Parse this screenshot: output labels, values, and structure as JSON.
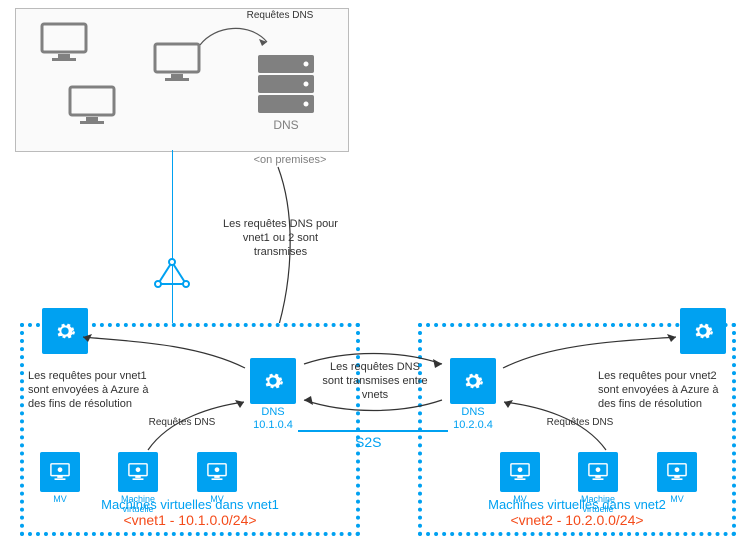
{
  "onprem": {
    "dns_label": "DNS",
    "onprem_label": "<on premises>",
    "requests_label": "Requêtes DNS"
  },
  "link": {
    "forward_note": "Les requêtes DNS pour vnet1 ou 2 sont transmises"
  },
  "center": {
    "between_note": "Les requêtes DNS sont transmises entre vnets",
    "s2s_label": "S2S"
  },
  "vnet1": {
    "resolve_note": "Les requêtes pour vnet1 sont envoyées à Azure à des fins de résolution",
    "req_label": "Requêtes DNS",
    "dns_label": "DNS",
    "dns_ip": "10.1.0.4",
    "vm1": "MV",
    "vm2": "Machine virtuelle",
    "vm3": "MV",
    "title": "Machines virtuelles dans vnet1",
    "cidr": "<vnet1 - 10.1.0.0/24>"
  },
  "vnet2": {
    "resolve_note": "Les requêtes pour vnet2 sont envoyées à Azure à des fins de résolution",
    "req_label": "Requêtes DNS",
    "dns_label": "DNS",
    "dns_ip": "10.2.0.4",
    "vm1": "MV",
    "vm2": "Machine virtuelle",
    "vm3": "MV",
    "title": "Machines virtuelles dans vnet2",
    "cidr": "<vnet2 - 10.2.0.0/24>"
  }
}
